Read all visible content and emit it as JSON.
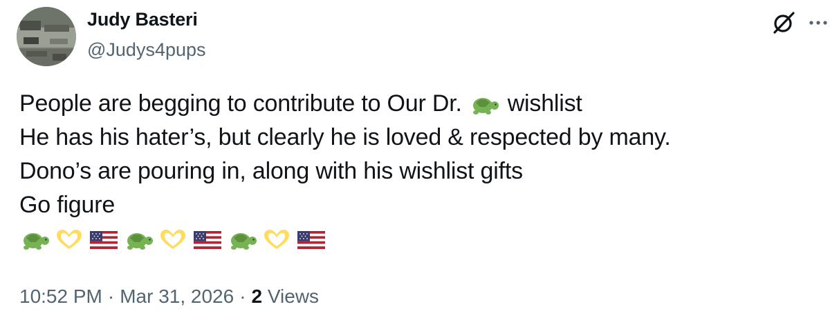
{
  "post": {
    "author": {
      "display_name": "Judy Basteri",
      "handle": "@Judys4pups",
      "avatar_icon": "profile-photo"
    },
    "actions": {
      "grok_icon": "grok-icon",
      "more_icon": "more-options-icon"
    },
    "text": {
      "line1_before_emoji": "People are begging to contribute to Our Dr.",
      "line1_emoji": "turtle",
      "line1_after_emoji": "wishlist",
      "line2": "He has his hater’s, but clearly he is loved & respected by many.",
      "line3": "Dono’s are pouring in, along with his wishlist gifts",
      "line4": "Go figure",
      "emoji_row": [
        "turtle",
        "heart-hands",
        "us-flag",
        "turtle",
        "heart-hands",
        "us-flag",
        "turtle",
        "heart-hands",
        "us-flag"
      ]
    },
    "meta": {
      "time": "10:52 PM",
      "separator": "·",
      "date": "Mar 31, 2026",
      "views_count": "2",
      "views_label": "Views"
    }
  },
  "colors": {
    "text": "#0f1419",
    "secondary": "#536471",
    "background": "#ffffff"
  }
}
